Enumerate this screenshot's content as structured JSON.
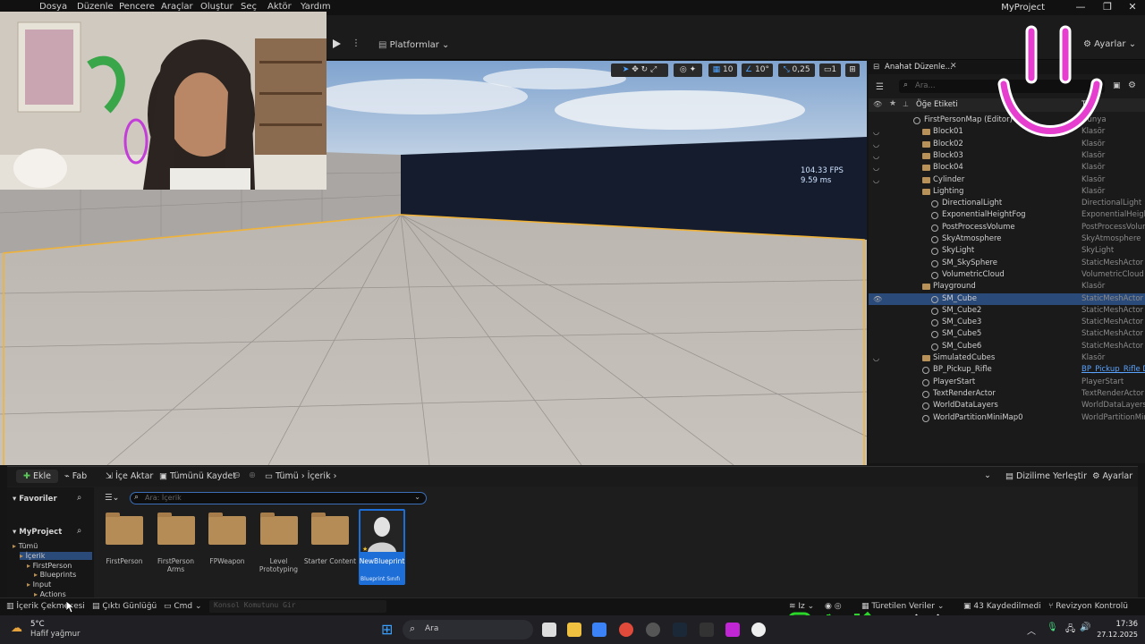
{
  "menu": [
    "Dosya",
    "Düzenle",
    "Pencere",
    "Araçlar",
    "Oluştur",
    "Seç",
    "Aktör",
    "Yardım"
  ],
  "window_title": "MyProject",
  "window_buttons": [
    "—",
    "❐",
    "✕"
  ],
  "toolbar": {
    "platforms": "Platformlar",
    "settings": "Ayarlar"
  },
  "viewport": {
    "fps": "104.33 FPS",
    "ms": "9.59 ms",
    "grid_snap": "10",
    "rot_snap": "10°",
    "scale_snap": "0,25",
    "cam_speed": "1"
  },
  "outliner": {
    "tab": "Anahat Düzenle...",
    "search_placeholder": "Ara...",
    "header_label": "Öğe Etiketi",
    "header_type": "Tipi",
    "rows": [
      {
        "name": "FirstPersonMap (Editor)",
        "type": "Dünya",
        "indent": 0,
        "kind": "map"
      },
      {
        "name": "Block01",
        "type": "Klasör",
        "indent": 1,
        "kind": "folder"
      },
      {
        "name": "Block02",
        "type": "Klasör",
        "indent": 1,
        "kind": "folder"
      },
      {
        "name": "Block03",
        "type": "Klasör",
        "indent": 1,
        "kind": "folder"
      },
      {
        "name": "Block04",
        "type": "Klasör",
        "indent": 1,
        "kind": "folder"
      },
      {
        "name": "Cylinder",
        "type": "Klasör",
        "indent": 1,
        "kind": "folder"
      },
      {
        "name": "Lighting",
        "type": "Klasör",
        "indent": 1,
        "kind": "folder"
      },
      {
        "name": "DirectionalLight",
        "type": "DirectionalLight",
        "indent": 2,
        "kind": "actor"
      },
      {
        "name": "ExponentialHeightFog",
        "type": "ExponentialHeight",
        "indent": 2,
        "kind": "actor"
      },
      {
        "name": "PostProcessVolume",
        "type": "PostProcessVolur",
        "indent": 2,
        "kind": "actor"
      },
      {
        "name": "SkyAtmosphere",
        "type": "SkyAtmosphere",
        "indent": 2,
        "kind": "actor"
      },
      {
        "name": "SkyLight",
        "type": "SkyLight",
        "indent": 2,
        "kind": "actor"
      },
      {
        "name": "SM_SkySphere",
        "type": "StaticMeshActor",
        "indent": 2,
        "kind": "actor"
      },
      {
        "name": "VolumetricCloud",
        "type": "VolumetricCloud",
        "indent": 2,
        "kind": "actor"
      },
      {
        "name": "Playground",
        "type": "Klasör",
        "indent": 1,
        "kind": "folder"
      },
      {
        "name": "SM_Cube",
        "type": "StaticMeshActor",
        "indent": 2,
        "kind": "actor",
        "selected": true
      },
      {
        "name": "SM_Cube2",
        "type": "StaticMeshActor",
        "indent": 2,
        "kind": "actor"
      },
      {
        "name": "SM_Cube3",
        "type": "StaticMeshActor",
        "indent": 2,
        "kind": "actor"
      },
      {
        "name": "SM_Cube5",
        "type": "StaticMeshActor",
        "indent": 2,
        "kind": "actor"
      },
      {
        "name": "SM_Cube6",
        "type": "StaticMeshActor",
        "indent": 2,
        "kind": "actor"
      },
      {
        "name": "SimulatedCubes",
        "type": "Klasör",
        "indent": 1,
        "kind": "folder"
      },
      {
        "name": "BP_Pickup_Rifle",
        "type": "BP_Pickup_Rifle D",
        "indent": 1,
        "kind": "actor",
        "link": true
      },
      {
        "name": "PlayerStart",
        "type": "PlayerStart",
        "indent": 1,
        "kind": "actor"
      },
      {
        "name": "TextRenderActor",
        "type": "TextRenderActor",
        "indent": 1,
        "kind": "actor"
      },
      {
        "name": "WorldDataLayers",
        "type": "WorldDataLayers",
        "indent": 1,
        "kind": "actor"
      },
      {
        "name": "WorldPartitionMiniMap0",
        "type": "WorldPartitionMin",
        "indent": 1,
        "kind": "actor"
      }
    ]
  },
  "content_browser": {
    "add": "Ekle",
    "fab": "Fab",
    "import": "İçe Aktar",
    "save_all": "Tümünü Kaydet",
    "crumb_all": "Tümü",
    "crumb_content": "İçerik",
    "dock": "Dizilime Yerleştir",
    "settings": "Ayarlar",
    "favorites": "Favoriler",
    "project": "MyProject",
    "search_placeholder": "Ara: İçerik",
    "tree": [
      "Tümü",
      "İçerik",
      "FirstPerson",
      "Blueprints",
      "Input",
      "Actions"
    ],
    "folders": [
      "FirstPerson",
      "FirstPerson Arms",
      "FPWeapon",
      "Level Prototyping",
      "Starter Content"
    ],
    "asset_name": "NewBlueprint",
    "asset_type": "Blueprint Sınıfı"
  },
  "statusbar": {
    "content_drawer": "İçerik Çekmecesi",
    "output_log": "Çıktı Günlüğü",
    "cmd": "Cmd",
    "console_placeholder": "Konsol Komutunu Gir",
    "derived": "Türetilen Veriler",
    "unsaved": "43 Kaydedilmedi",
    "revision": "Revizyon Kontrolü",
    "iz": "Iz"
  },
  "taskbar": {
    "temp": "5°C",
    "weather": "Hafif yağmur",
    "search": "Ara",
    "time": "17:36",
    "date": "27.12.2025"
  },
  "colors": {
    "accent": "#1e6ed8",
    "selection": "#2a4a7a",
    "overlay_pink": "#e63fd0"
  }
}
